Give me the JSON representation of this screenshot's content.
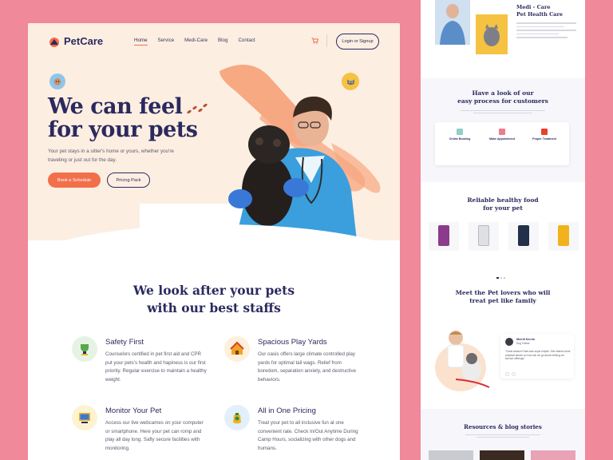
{
  "brand": {
    "name": "PetCare",
    "accent": "#f26f4b",
    "navy": "#2b2a5e",
    "background": "#f0899a",
    "hero_bg": "#fdeee2"
  },
  "nav": {
    "links": [
      {
        "label": "Home",
        "active": true
      },
      {
        "label": "Service",
        "active": false
      },
      {
        "label": "Medi-Care",
        "active": false
      },
      {
        "label": "Blog",
        "active": false
      },
      {
        "label": "Contact",
        "active": false
      }
    ],
    "cart_icon": "cart-icon",
    "login_label": "Login or Signup"
  },
  "hero": {
    "title_line1": "We can feel",
    "title_line2": "for your pets",
    "description": "Your pet stays in a sitter's home or yours, whether you're traveling or just out for the day.",
    "primary_button": "Book a Schedule",
    "secondary_button": "Pricing Pack"
  },
  "staff_section": {
    "title_line1": "We look after your pets",
    "title_line2": "with our best staffs",
    "features": [
      {
        "title": "Safety First",
        "icon": "trophy-icon",
        "icon_bg": "#e6f3e4",
        "description": "Counselors certified in pet first aid and CPR put your pets's health and hapiness is our first priority. Regular exercise to maintain a healthy weight."
      },
      {
        "title": "Spacious Play Yards",
        "icon": "pet-house-icon",
        "icon_bg": "#fdf0dc",
        "description": "Our oasis offers large climate controlled play yards for optimal tail wags. Relief from boredom, separation anxiety, and destructive behaviors."
      },
      {
        "title": "Monitor Your Pet",
        "icon": "monitor-icon",
        "icon_bg": "#fdf3d2",
        "description": "Access our live webcames on your computer or smartphone. Here your pet can romp and play all day long. Safly secure facilities with monitoring."
      },
      {
        "title": "All in One Pricing",
        "icon": "pricing-bag-icon",
        "icon_bg": "#e2f0fb",
        "description": "Treat your pet to all inclusive fun at one convenient rate. Check In/Out Anytime During Camp Hours, socializing with other dogs and humans."
      }
    ]
  },
  "preview": {
    "medicare_title_line1": "Medi - Care",
    "medicare_title_line2": "Pet Health Care",
    "process_title_line1": "Have a look of our",
    "process_title_line2": "easy process for customers",
    "process_steps": [
      "Online Booking",
      "Make Appointment",
      "Proper Treatment"
    ],
    "food_title_line1": "Reliable healthy food",
    "food_title_line2": "for your pet",
    "food_colors": [
      "#8b3a8c",
      "#dfe0e4",
      "#22304a",
      "#f2b21c"
    ],
    "lovers_title_line1": "Meet the Pet lovers who will",
    "lovers_title_line2": "treat pet like family",
    "testimonial_name": "Merrill Kervin",
    "testimonial_role": "Dog Trainer",
    "testimonial_quote": "\"Great session! Dani was super helpful. She shared some practical advice on how can we go about refining our service offerings.\"",
    "blog_title": "Resources & blog stories"
  }
}
